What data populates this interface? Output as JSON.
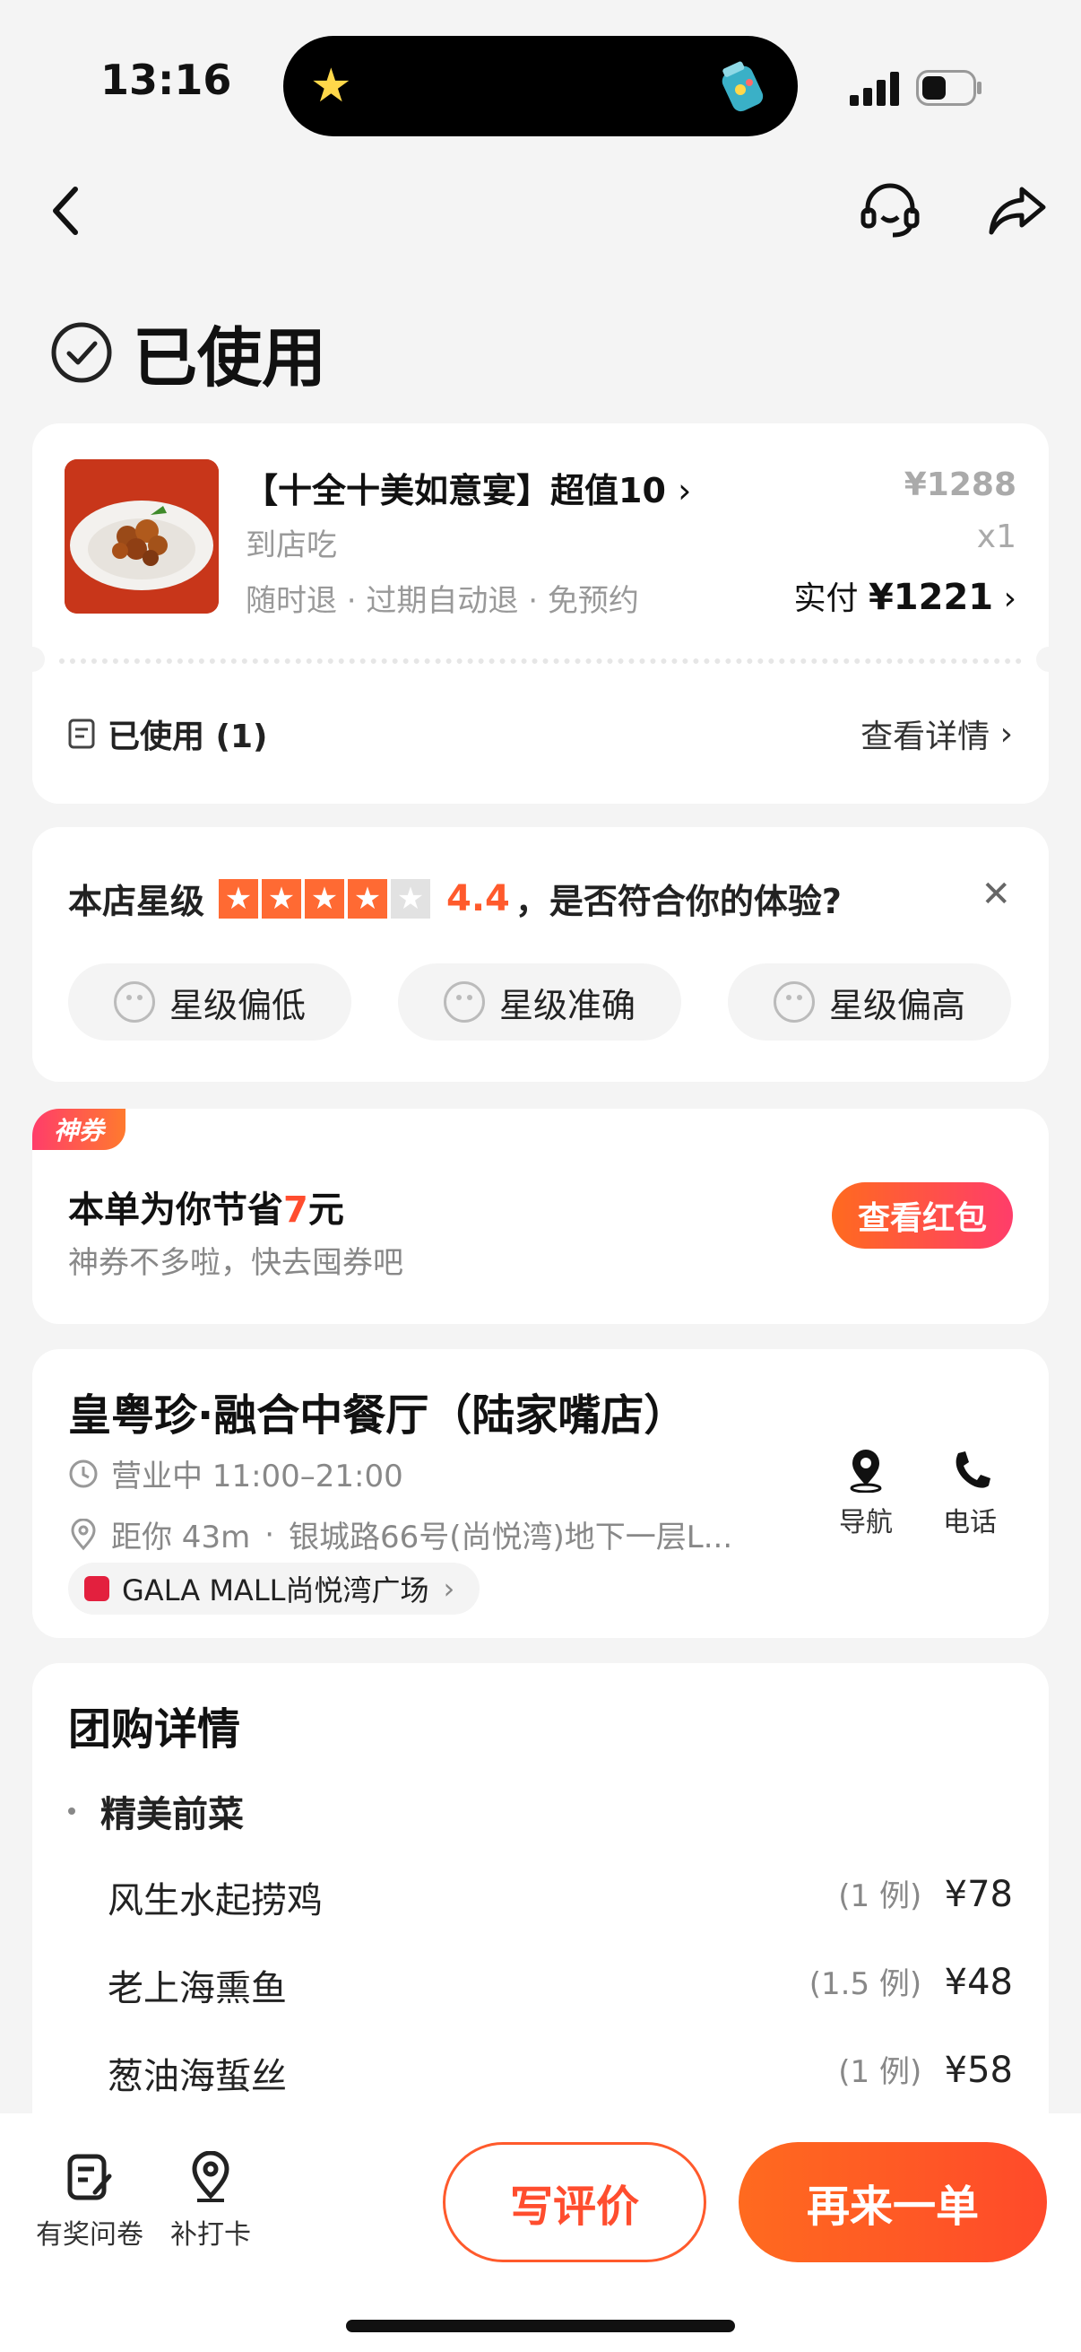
{
  "status_bar": {
    "time": "13:16"
  },
  "header": {
    "status_title": "已使用"
  },
  "order": {
    "title": "【十全十美如意宴】超值10",
    "type": "到店吃",
    "tags": "随时退 · 过期自动退 · 免预约",
    "original_price": "¥1288",
    "quantity": "x1",
    "paid_label": "实付",
    "paid_amount": "¥1221",
    "used_label": "已使用 (1)",
    "detail_link": "查看详情"
  },
  "rating": {
    "label": "本店星级",
    "score": "4.4",
    "stars_filled": 4,
    "stars_total": 5,
    "question": "，是否符合你的体验?",
    "options": [
      "星级偏低",
      "星级准确",
      "星级偏高"
    ]
  },
  "coupon": {
    "badge": "神券",
    "title_prefix": "本单为你节省",
    "amount": "7",
    "title_suffix": "元",
    "subtitle": "神券不多啦，快去囤券吧",
    "button": "查看红包"
  },
  "store": {
    "name": "皇粤珍·融合中餐厅（陆家嘴店）",
    "hours": "营业中 11:00–21:00",
    "distance": "距你 43m",
    "address": "银城路66号(尚悦湾)地下一层L...",
    "mall": "GALA MALL尚悦湾广场",
    "nav_label": "导航",
    "phone_label": "电话"
  },
  "group_buy": {
    "title": "团购详情",
    "section": "精美前菜",
    "items": [
      {
        "name": "风生水起捞鸡",
        "qty": "(1 例)",
        "price": "¥78"
      },
      {
        "name": "老上海熏鱼",
        "qty": "(1.5 例)",
        "price": "¥48"
      },
      {
        "name": "葱油海蜇丝",
        "qty": "(1 例)",
        "price": "¥58"
      }
    ]
  },
  "bottom_bar": {
    "survey": "有奖问卷",
    "checkin": "补打卡",
    "review": "写评价",
    "reorder": "再来一单"
  },
  "colors": {
    "accent": "#ff5a2c",
    "gradient_start": "#ff6a1f",
    "gradient_end": "#ff3d6a",
    "background": "#f4f4f4"
  }
}
